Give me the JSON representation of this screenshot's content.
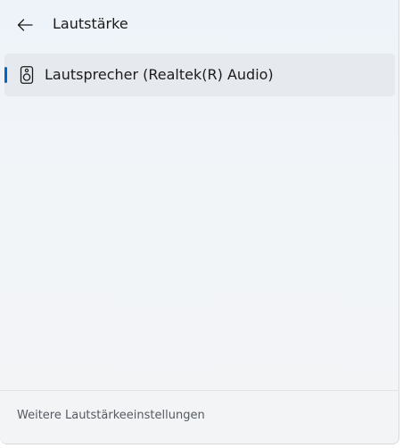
{
  "header": {
    "title": "Lautstärke",
    "back_icon": "arrow-left-icon"
  },
  "devices": [
    {
      "label": "Lautsprecher (Realtek(R) Audio)",
      "icon": "speaker-icon",
      "selected": true
    }
  ],
  "footer": {
    "link_label": "Weitere Lautstärkeeinstellungen"
  },
  "colors": {
    "accent": "#0067c0",
    "selected_background": "#e6e9ee",
    "text_primary": "#1b1b1b",
    "text_secondary": "#555a60"
  }
}
